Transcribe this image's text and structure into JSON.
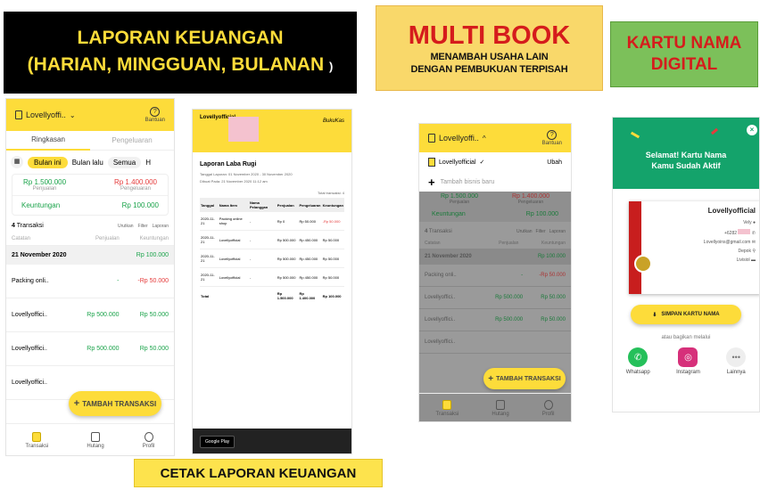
{
  "banners": {
    "laporan_title": "LAPORAN KEUANGAN",
    "laporan_sub": "(HARIAN, MINGGUAN, BULANAN",
    "laporan_paren": ")",
    "multibook_title": "MULTI BOOK",
    "multibook_line1": "MENAMBAH USAHA LAIN",
    "multibook_line2": "DENGAN PEMBUKUAN TERPISAH",
    "kartu_line1": "KARTU NAMA",
    "kartu_line2": "DIGITAL",
    "cetak": "CETAK LAPORAN KEUANGAN"
  },
  "phone1": {
    "business": "Lovellyoffi..",
    "help": "Bantuan",
    "tabs": [
      "Ringkasan",
      "Pengeluaran"
    ],
    "filters": [
      "Bulan ini",
      "Bulan lalu",
      "Semua",
      "H"
    ],
    "income_value": "Rp 1.500.000",
    "income_label": "Penjualan",
    "expense_value": "Rp 1.400.000",
    "expense_label": "Pengeluaran",
    "profit_label": "Keuntungan",
    "profit_value": "Rp 100.000",
    "tx_count": "4",
    "tx_label": "Transaksi",
    "tools": [
      "Urutkan",
      "Filter",
      "Laporan"
    ],
    "cols": [
      "Catatan",
      "Penjualan",
      "Keuntungan"
    ],
    "date": "21 November 2020",
    "date_total": "Rp 100.000",
    "rows": [
      {
        "name": "Packing onli..",
        "sale": "-",
        "profit": "-Rp 50.000"
      },
      {
        "name": "Lovellyoffici..",
        "sale": "Rp 500.000",
        "profit": "Rp 50.000"
      },
      {
        "name": "Lovellyoffici..",
        "sale": "Rp 500.000",
        "profit": "Rp 50.000"
      },
      {
        "name": "Lovellyoffici..",
        "sale": "",
        "profit": ""
      }
    ],
    "fab": "TAMBAH TRANSAKSI",
    "nav": [
      "Transaksi",
      "Hutang",
      "Profil"
    ]
  },
  "phone2": {
    "shop": "Lovellyofficial",
    "brand": "BukuKas",
    "title": "Laporan Laba Rugi",
    "meta1": "Tanggal Laporan: 01 November 2020 - 30 November 2020",
    "meta2": "Dibuat Pada: 21 November 2020 11:12 am",
    "total_tx": "Total transaksi: 4",
    "cols": [
      "Tanggal",
      "Nama Item",
      "Nama Pelanggan",
      "Penjualan",
      "Pengeluaran",
      "Keuntungan"
    ],
    "rows": [
      [
        "2020-11-21",
        "Packing online shop",
        "-",
        "Rp 0",
        "Rp 50.000",
        "-Rp 50.000"
      ],
      [
        "2020-11-21",
        "Lovellyofficial",
        "-",
        "Rp 500.000",
        "Rp 450.000",
        "Rp 50.000"
      ],
      [
        "2020-11-21",
        "Lovellyofficial",
        "-",
        "Rp 500.000",
        "Rp 450.000",
        "Rp 50.000"
      ],
      [
        "2020-11-21",
        "Lovellyofficial",
        "-",
        "Rp 500.000",
        "Rp 450.000",
        "Rp 50.000"
      ]
    ],
    "total_label": "Total",
    "total": [
      "Rp 1.500.000",
      "Rp 1.400.000",
      "Rp 100.000"
    ],
    "store": "Google Play"
  },
  "phone3": {
    "business": "Lovellyoffi..",
    "help": "Bantuan",
    "book_item": "Lovellyofficial",
    "edit": "Ubah",
    "add_book": "Tambah bisnis baru",
    "income_value": "Rp 1.500.000",
    "income_label": "Penjualan",
    "expense_value": "Rp 1.400.000",
    "expense_label": "Pengeluaran",
    "profit_label": "Keuntungan",
    "profit_value": "Rp 100.000",
    "tx_count": "4",
    "tx_label": "Transaksi",
    "tools": [
      "Urutkan",
      "Filter",
      "Laporan"
    ],
    "cols": [
      "Catatan",
      "Penjualan",
      "Keuntungan"
    ],
    "date": "21 November 2020",
    "date_total": "Rp 100.000",
    "rows": [
      {
        "name": "Packing onli..",
        "sale": "-",
        "profit": "-Rp 50.000"
      },
      {
        "name": "Lovellyoffici..",
        "sale": "Rp 500.000",
        "profit": "Rp 50.000"
      },
      {
        "name": "Lovellyoffici..",
        "sale": "Rp 500.000",
        "profit": "Rp 50.000"
      },
      {
        "name": "Lovellyoffici..",
        "sale": "",
        "profit": ""
      }
    ],
    "fab": "TAMBAH TRANSAKSI",
    "nav": [
      "Transaksi",
      "Hutang",
      "Profil"
    ]
  },
  "phone4": {
    "headline1": "Selamat! Kartu Nama",
    "headline2": "Kamu Sudah Aktif",
    "card_name": "Lovellyofficial",
    "contact_name": "Vely",
    "phone": "+6282",
    "email": "Lovellyoins@gmail.com",
    "city": "Depok",
    "social": "Livisiol",
    "save": "SIMPAN KARTU NAMA",
    "share_label": "atau bagikan melalui",
    "share": [
      "Whatsapp",
      "Instagram",
      "Lainnya"
    ]
  }
}
